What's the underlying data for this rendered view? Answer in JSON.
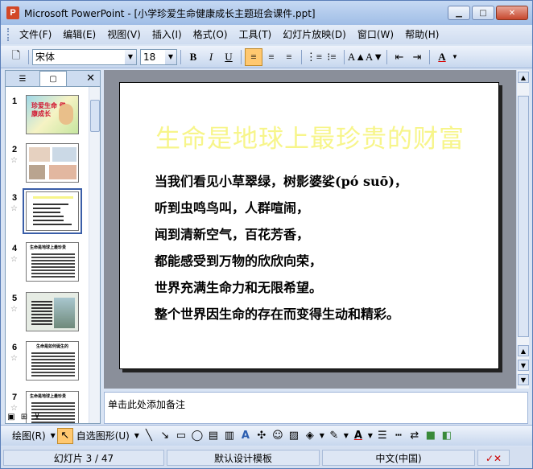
{
  "window": {
    "title": "Microsoft PowerPoint - [小学珍爱生命健康成长主题班会课件.ppt]",
    "app_icon": "P",
    "controls": {
      "minimize": "▁",
      "maximize": "□",
      "close": "✕"
    }
  },
  "menu": [
    "文件(F)",
    "编辑(E)",
    "视图(V)",
    "插入(I)",
    "格式(O)",
    "工具(T)",
    "幻灯片放映(D)",
    "窗口(W)",
    "帮助(H)"
  ],
  "toolbar": {
    "font_name": "宋体",
    "font_size": "18",
    "bold": "B",
    "italic": "I",
    "underline": "U",
    "font_color_label": "A"
  },
  "slides_pane": {
    "thumbnails": [
      {
        "num": "1",
        "star": ""
      },
      {
        "num": "2",
        "star": "☆"
      },
      {
        "num": "3",
        "star": "☆"
      },
      {
        "num": "4",
        "star": "☆"
      },
      {
        "num": "5",
        "star": "☆"
      },
      {
        "num": "6",
        "star": "☆"
      },
      {
        "num": "7",
        "star": "☆"
      }
    ],
    "thumb1_text": "珍爱生命 健康成长",
    "thumb4_text": "生命是地球上最珍贵",
    "thumb6_text": "生命是如何诞生的",
    "thumb7_text": "生命是地球上最珍贵"
  },
  "slide": {
    "title": "生命是地球上最珍贵的财富",
    "lines": [
      "当我们看见小草翠绿，树影婆娑(pó suō)，",
      "听到虫鸣鸟叫，人群喧闹，",
      "闻到清新空气，百花芳香，",
      "都能感受到万物的欣欣向荣，",
      "世界充满生命力和无限希望。",
      "整个世界因生命的存在而变得生动和精彩。"
    ]
  },
  "notes": {
    "placeholder": "单击此处添加备注"
  },
  "drawing_toolbar": {
    "draw_label": "绘图(R)",
    "autoshapes_label": "自选图形(U)"
  },
  "status": {
    "slide_pos": "幻灯片 3 / 47",
    "design": "默认设计模板",
    "language": "中文(中国)"
  },
  "colors": {
    "title_yellow": "#f7f58a",
    "selected_thumb_border": "#3a5ea8"
  }
}
